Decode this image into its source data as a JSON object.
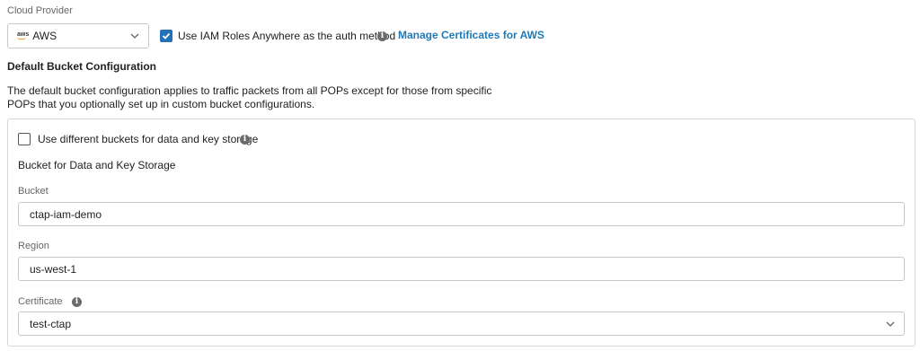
{
  "cloud_provider": {
    "label": "Cloud Provider",
    "selected": "AWS",
    "logo_text": "aws",
    "icon": "chevron-down-icon"
  },
  "iam": {
    "checked": true,
    "label": "Use IAM Roles Anywhere as the auth method",
    "manage_link": "Manage Certificates for AWS"
  },
  "default_bucket": {
    "heading": "Default Bucket Configuration",
    "description_line1": "The default bucket configuration applies to traffic packets from all POPs except for those from specific",
    "description_line2": "POPs that you optionally set up in custom bucket configurations."
  },
  "panel": {
    "different_buckets_checked": false,
    "different_buckets_label": "Use different buckets for data and key storage",
    "section_title": "Bucket for Data and Key Storage",
    "bucket_label": "Bucket",
    "bucket_value": "ctap-iam-demo",
    "region_label": "Region",
    "region_value": "us-west-1",
    "certificate_label": "Certificate",
    "certificate_value": "test-ctap"
  },
  "colors": {
    "accent": "#2471b7",
    "link": "#1f7ab8",
    "border": "#c8c8c8"
  }
}
